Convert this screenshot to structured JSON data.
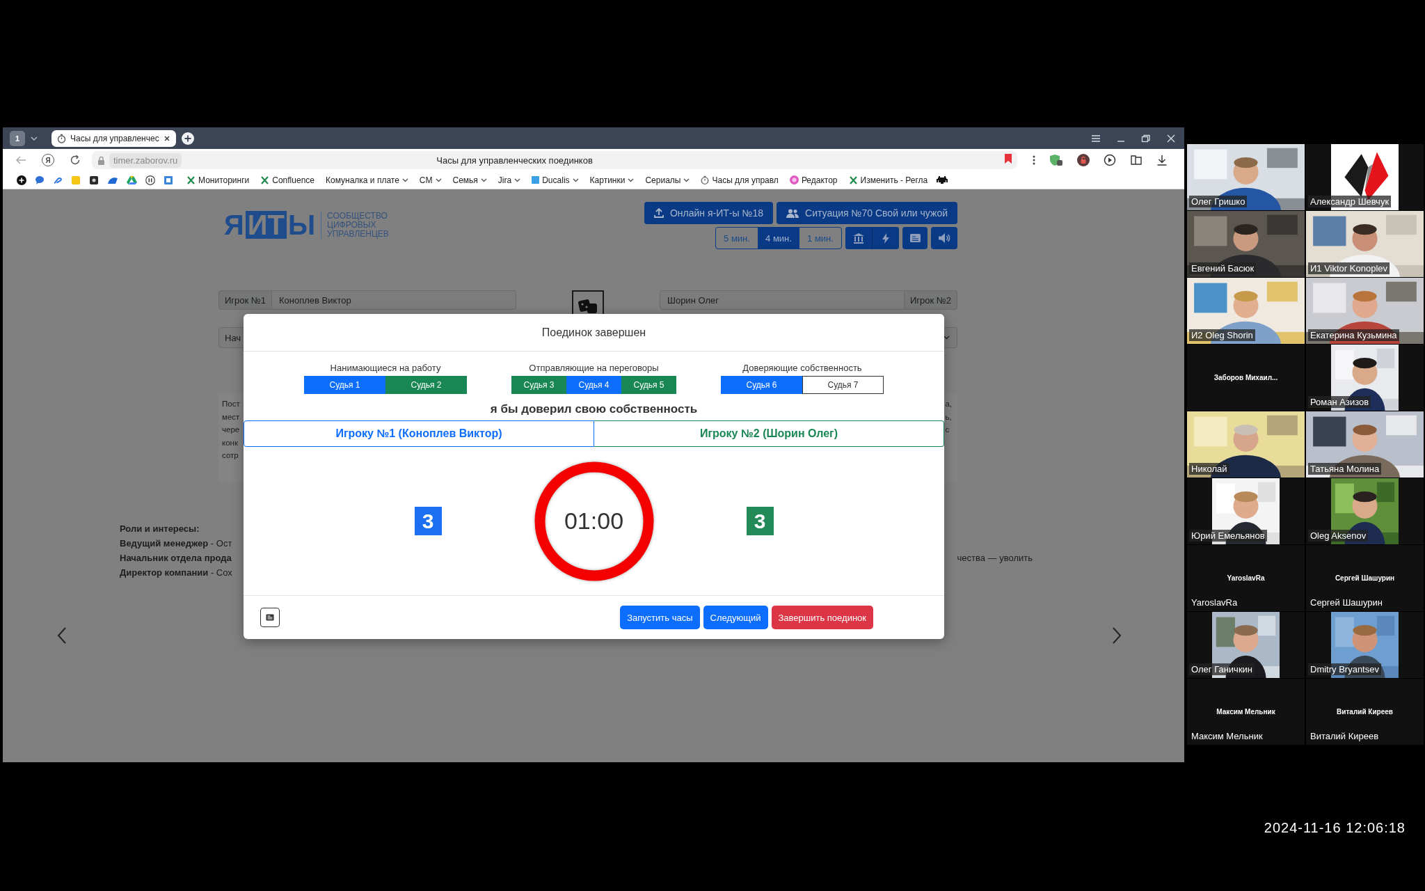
{
  "browser": {
    "tab_count": "1",
    "tab_title": "Часы для управленчес",
    "home_glyph": "Я",
    "url": "timer.zaborov.ru",
    "page_title": "Часы для управленческих поединков",
    "bookmarks": [
      {
        "label": "Мониторинги",
        "kind": "xmark",
        "dropdown": false
      },
      {
        "label": "Confluence",
        "kind": "xmark",
        "dropdown": false
      },
      {
        "label": "Комуналка и плате",
        "kind": "plain",
        "dropdown": true
      },
      {
        "label": "CM",
        "kind": "plain",
        "dropdown": true
      },
      {
        "label": "Семья",
        "kind": "plain",
        "dropdown": true
      },
      {
        "label": "Jira",
        "kind": "plain",
        "dropdown": true
      },
      {
        "label": "Ducalis",
        "kind": "square",
        "dropdown": true
      },
      {
        "label": "Картинки",
        "kind": "plain",
        "dropdown": true
      },
      {
        "label": "Сериалы",
        "kind": "plain",
        "dropdown": true
      },
      {
        "label": "Часы для управл",
        "kind": "clock",
        "dropdown": false
      },
      {
        "label": "Редактор",
        "kind": "dot",
        "dropdown": false
      },
      {
        "label": "Изменить - Регла",
        "kind": "xmark",
        "dropdown": false
      }
    ]
  },
  "page": {
    "logo": [
      "Я",
      "ИТ",
      "Ы"
    ],
    "tagline": [
      "СООБЩЕСТВО",
      "ЦИФРОВЫХ",
      "УПРАВЛЕНЦЕВ"
    ],
    "top_buttons": [
      "Онлайн я-ИТ-ы №18",
      "Ситуация №70 Свой или чужой"
    ],
    "durations": [
      {
        "label": "5 мин.",
        "selected": false
      },
      {
        "label": "4 мин.",
        "selected": true
      },
      {
        "label": "1 мин.",
        "selected": false
      }
    ],
    "player1": {
      "label": "Игрок №1",
      "name": "Коноплев Виктор"
    },
    "player2": {
      "label": "Игрок №2",
      "name": "Шорин Олег"
    },
    "select_value": "Нач",
    "description_left": [
      "Пост",
      "мест",
      "чере",
      "конк",
      "сотр"
    ],
    "description_right": [
      "а,",
      "ь,",
      "с"
    ],
    "roles_title": "Роли и интересы:",
    "roles": [
      {
        "role": "Ведущий менеджер",
        "detail": " - Ост"
      },
      {
        "role": "Начальник отдела прода"
      },
      {
        "role": "Директор компании",
        "detail": " - Сох"
      }
    ],
    "roles_right": "чества — уволить"
  },
  "modal": {
    "title": "Поединок завершен",
    "groups": [
      {
        "label": "Нанимающиеся на работу",
        "judges": [
          {
            "name": "Судья 1",
            "color": "#0d6efd"
          },
          {
            "name": "Судья 2",
            "color": "#198754"
          }
        ]
      },
      {
        "label": "Отправляющие на переговоры",
        "judges": [
          {
            "name": "Судья 3",
            "color": "#198754"
          },
          {
            "name": "Судья 4",
            "color": "#0d6efd"
          },
          {
            "name": "Судья 5",
            "color": "#198754"
          }
        ]
      },
      {
        "label": "Доверяющие собственность",
        "judges": [
          {
            "name": "Судья 6",
            "color": "#0d6efd"
          },
          {
            "name": "Судья 7",
            "color": "#ffffff"
          }
        ]
      }
    ],
    "question": "я бы доверил свою собственность",
    "choices": [
      {
        "label": "Игроку №1 (Коноплев Виктор)",
        "selected": false
      },
      {
        "label": "Игроку №2 (Шорин Олег)",
        "selected": false
      }
    ],
    "score1": "3",
    "score2": "3",
    "timer": "01:00",
    "buttons": [
      {
        "label": "Запустить часы",
        "kind": "primary"
      },
      {
        "label": "Следующий",
        "kind": "primary"
      },
      {
        "label": "Завершить поединок",
        "kind": "danger"
      }
    ]
  },
  "participants": [
    {
      "kind": "video",
      "name": "Олег Гришко"
    },
    {
      "name": "Александр Шевчук"
    },
    {
      "kind": "video",
      "name": "Евгений Басюк"
    },
    {
      "kind": "video",
      "name": "И1 Viktor Konoplev"
    },
    {
      "kind": "video",
      "name": "И2 Oleg Shorin"
    },
    {
      "kind": "video",
      "name": "Екатерина Кузьмина"
    },
    {
      "kind": "text",
      "caption": "Заборов Михаил..."
    },
    {
      "name": "Роман Азизов"
    },
    {
      "kind": "video",
      "name": "Николай"
    },
    {
      "kind": "video",
      "name": "Татьяна Молина"
    },
    {
      "name": "Юрий Емельянов"
    },
    {
      "name": "Oleg Aksenov"
    },
    {
      "kind": "text",
      "caption": "YaroslavRa",
      "name": "YaroslavRa"
    },
    {
      "kind": "text",
      "caption": "Сергей Шашурин",
      "name": "Сергей Шашурин"
    },
    {
      "name": "Олег Ганичкин"
    },
    {
      "name": "Dmitry Bryantsev"
    },
    {
      "kind": "text",
      "caption": "Максим Мельник",
      "name": "Максим Мельник"
    },
    {
      "kind": "text",
      "caption": "Виталий Киреев",
      "name": "Виталий Киреев"
    }
  ],
  "timestamp": "2024-11-16 12:06:18"
}
